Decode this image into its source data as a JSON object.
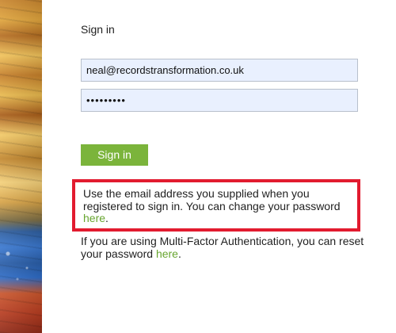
{
  "colors": {
    "accent_green": "#7bb43b",
    "link_green": "#67a52f",
    "highlight_red": "#e21b2f",
    "input_bg": "#e9f0fe"
  },
  "sign_in": {
    "title": "Sign in",
    "email_value": "neal@recordstransformation.co.uk",
    "password_value": "•••••••••",
    "button_label": "Sign in"
  },
  "notice": {
    "text": "Use the email address you supplied when you registered to sign in. You can change your password ",
    "link_label": "here",
    "suffix": "."
  },
  "mfa": {
    "text": "If you are using Multi-Factor Authentication, you can reset your password ",
    "link_label": "here",
    "suffix": "."
  }
}
